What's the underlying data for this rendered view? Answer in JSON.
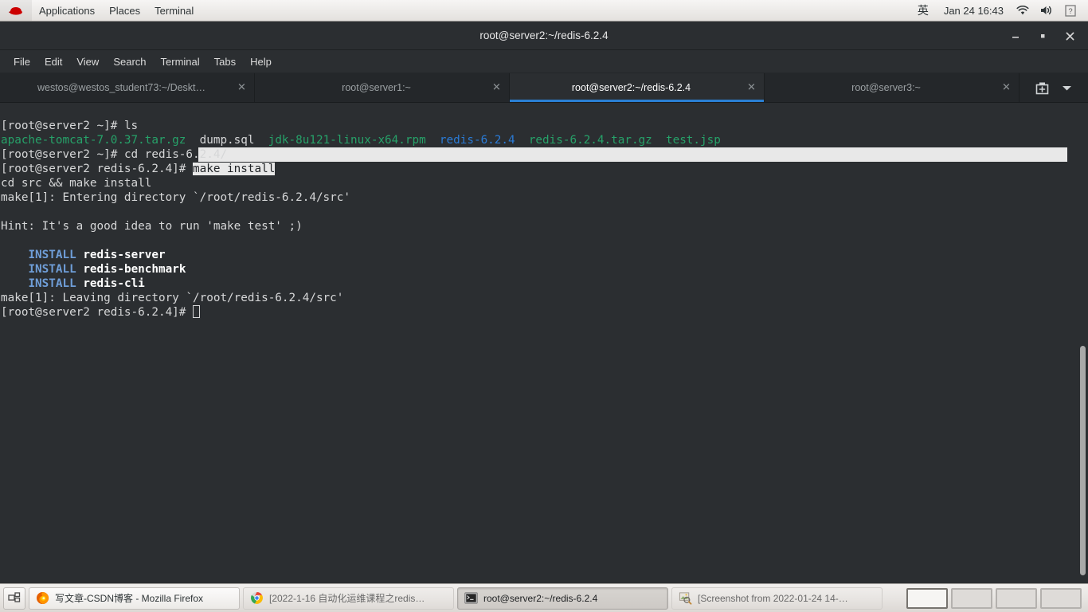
{
  "top_panel": {
    "menus": [
      "Applications",
      "Places",
      "Terminal"
    ],
    "ime_indicator": "英",
    "clock": "Jan 24 16:43",
    "icons": [
      "wifi-icon",
      "volume-icon",
      "power-icon"
    ]
  },
  "window": {
    "title": "root@server2:~/redis-6.2.4",
    "controls": {
      "minimize": "–",
      "maximize": "■",
      "close": "✕"
    }
  },
  "menu_bar": [
    "File",
    "Edit",
    "View",
    "Search",
    "Terminal",
    "Tabs",
    "Help"
  ],
  "tabs": [
    {
      "label": "westos@westos_student73:~/Deskt…",
      "active": false,
      "close": "✕"
    },
    {
      "label": "root@server1:~",
      "active": false,
      "close": "✕"
    },
    {
      "label": "root@server2:~/redis-6.2.4",
      "active": true,
      "close": "✕"
    },
    {
      "label": "root@server3:~",
      "active": false,
      "close": "✕"
    }
  ],
  "tab_tools": {
    "new_tab": "new-tab-icon",
    "menu": "chevron-down-icon"
  },
  "terminal": {
    "prompt_home": "[root@server2 ~]# ",
    "prompt_dir": "[root@server2 redis-6.2.4]# ",
    "cmd_ls": "ls",
    "cmd_cd": "cd redis-6.2.4/",
    "cmd_make": "make install",
    "ls_output": [
      {
        "name": "apache-tomcat-7.0.37.tar.gz",
        "color": "green"
      },
      {
        "name": "dump.sql",
        "color": "white"
      },
      {
        "name": "jdk-8u121-linux-x64.rpm",
        "color": "green"
      },
      {
        "name": "redis-6.2.4",
        "color": "blue"
      },
      {
        "name": "redis-6.2.4.tar.gz",
        "color": "green"
      },
      {
        "name": "test.jsp",
        "color": "green"
      }
    ],
    "make_lines": [
      "cd src && make install",
      "make[1]: Entering directory `/root/redis-6.2.4/src'",
      "",
      "Hint: It's a good idea to run 'make test' ;)",
      ""
    ],
    "install_lines": [
      {
        "action": "INSTALL",
        "target": "redis-server"
      },
      {
        "action": "INSTALL",
        "target": "redis-benchmark"
      },
      {
        "action": "INSTALL",
        "target": "redis-cli"
      }
    ],
    "leaving_line": "make[1]: Leaving directory `/root/redis-6.2.4/src'",
    "colors": {
      "background": "#2b2e31",
      "foreground": "#d6d7d8",
      "green": "#26a269",
      "blue": "#2a7bd6",
      "light_blue": "#6f9ed8",
      "selection_bg": "#e8e8e8",
      "accent": "#2a7fd4"
    }
  },
  "taskbar": {
    "show_desktop": "show-desktop-icon",
    "items": [
      {
        "label": "写文章-CSDN博客 - Mozilla Firefox",
        "icon": "firefox-icon",
        "state": "normal"
      },
      {
        "label": "[2022-1-16 自动化运维课程之redis…",
        "icon": "chrome-icon",
        "state": "inactive"
      },
      {
        "label": "root@server2:~/redis-6.2.4",
        "icon": "terminal-icon",
        "state": "active"
      },
      {
        "label": "[Screenshot from 2022-01-24 14-…",
        "icon": "image-viewer-icon",
        "state": "inactive"
      }
    ],
    "workspaces": [
      {
        "name": "workspace-1",
        "active": true
      },
      {
        "name": "workspace-2",
        "active": false
      },
      {
        "name": "workspace-3",
        "active": false
      },
      {
        "name": "workspace-4",
        "active": false
      }
    ]
  }
}
